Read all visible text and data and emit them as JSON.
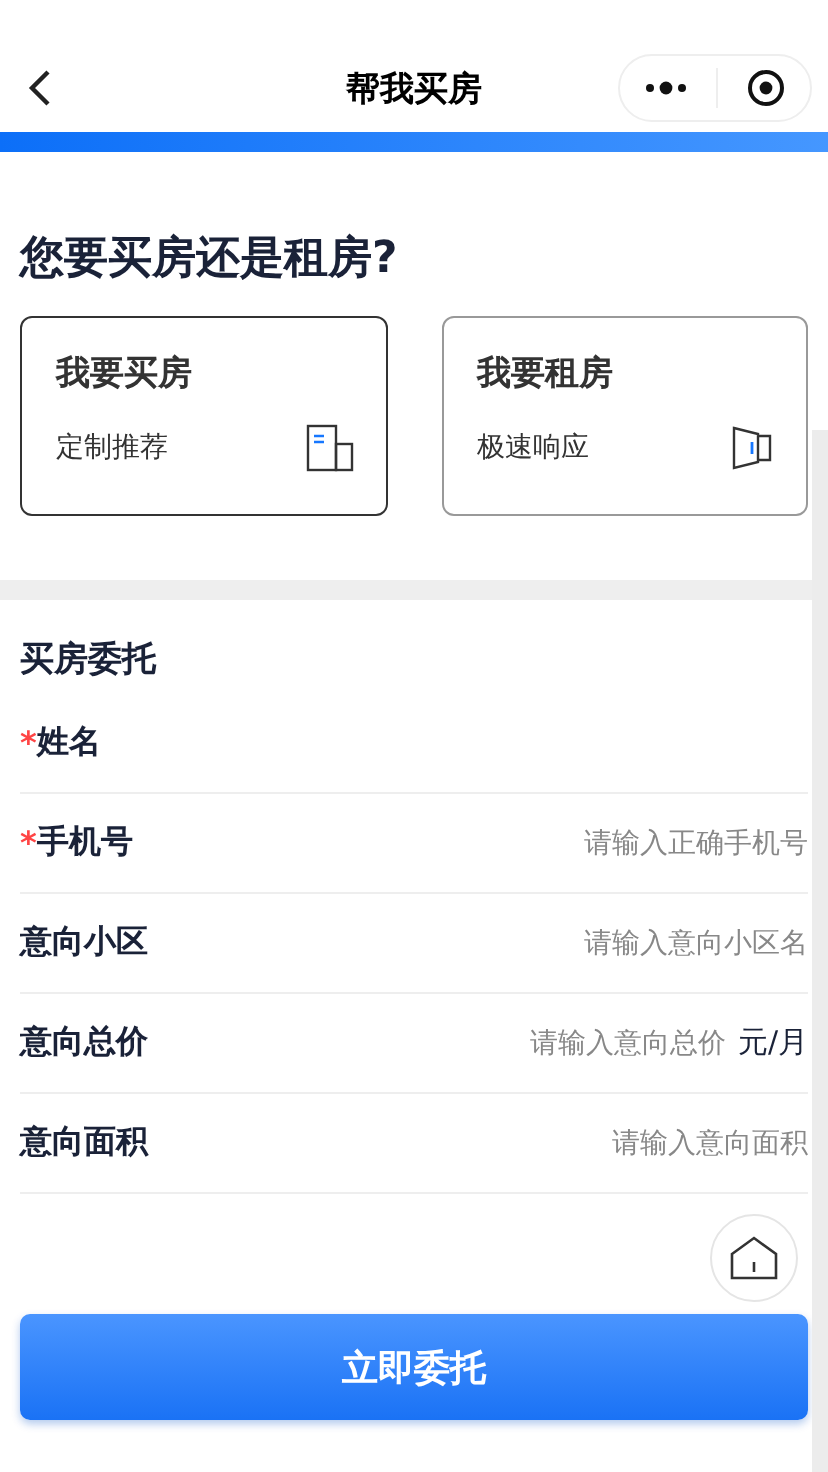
{
  "nav": {
    "title": "帮我买房"
  },
  "question": "您要买房还是租房?",
  "options": [
    {
      "title": "我要买房",
      "subtitle": "定制推荐",
      "kind": "buy",
      "selected": true
    },
    {
      "title": "我要租房",
      "subtitle": "极速响应",
      "kind": "rent",
      "selected": false
    }
  ],
  "form": {
    "title": "买房委托",
    "required_mark": "*",
    "fields": [
      {
        "label": "姓名",
        "required": true
      },
      {
        "label": "手机号",
        "required": true,
        "placeholder": "请输入正确手机号"
      },
      {
        "label": "意向小区",
        "required": false,
        "placeholder": "请输入意向小区名"
      },
      {
        "label": "意向总价",
        "required": false,
        "placeholder": "请输入意向总价",
        "unit": "元/月"
      },
      {
        "label": "意向面积",
        "required": false,
        "placeholder": "请输入意向面积"
      }
    ]
  },
  "submit": "立即委托"
}
